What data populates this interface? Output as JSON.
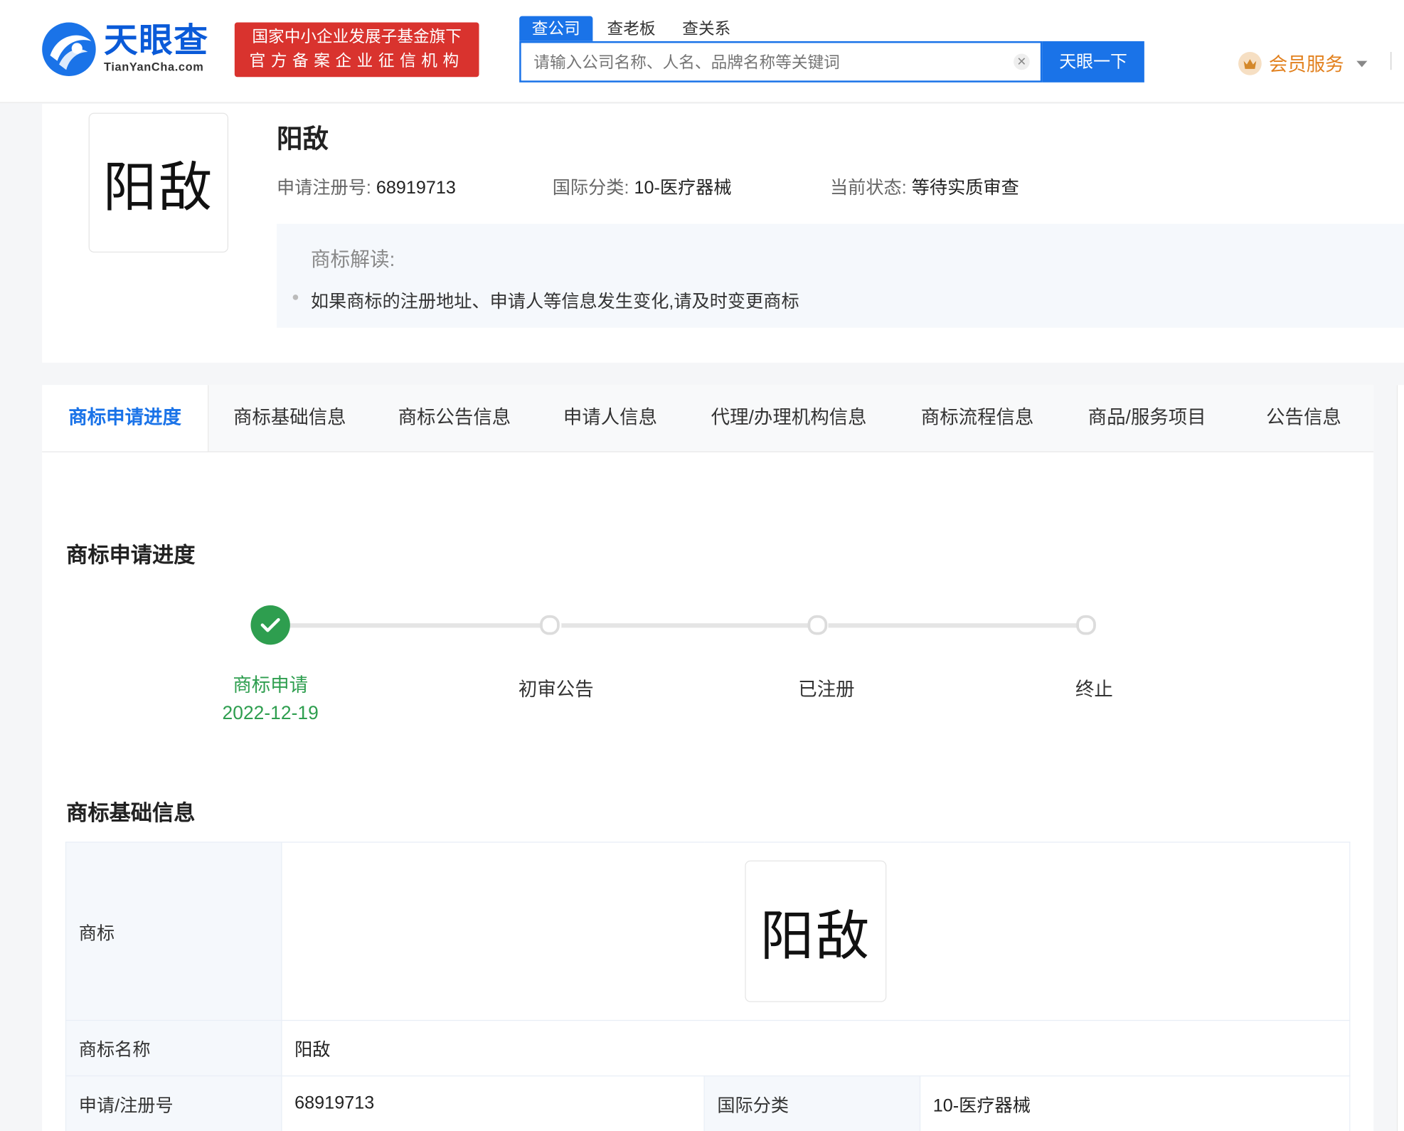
{
  "header": {
    "logo_cn": "天眼查",
    "logo_en": "TianYanCha.com",
    "slogan_line1": "国家中小企业发展子基金旗下",
    "slogan_line2": "官方备案企业征信机构",
    "search_tabs": [
      "查公司",
      "查老板",
      "查关系"
    ],
    "search_placeholder": "请输入公司名称、人名、品牌名称等关键词",
    "search_button": "天眼一下",
    "vip_label": "会员服务"
  },
  "trademark": {
    "logo_text": "阳敌",
    "name": "阳敌",
    "reg_no_label": "申请注册号:",
    "reg_no": "68919713",
    "class_label": "国际分类:",
    "class_value": "10-医疗器械",
    "status_label": "当前状态:",
    "status_value": "等待实质审查",
    "interp_title": "商标解读:",
    "interp_item": "如果商标的注册地址、申请人等信息发生变化,请及时变更商标"
  },
  "tabs": [
    "商标申请进度",
    "商标基础信息",
    "商标公告信息",
    "申请人信息",
    "代理/办理机构信息",
    "商标流程信息",
    "商品/服务项目",
    "公告信息"
  ],
  "progress": {
    "title": "商标申请进度",
    "steps": [
      {
        "label": "商标申请",
        "date": "2022-12-19",
        "done": true
      },
      {
        "label": "初审公告",
        "done": false
      },
      {
        "label": "已注册",
        "done": false
      },
      {
        "label": "终止",
        "done": false
      }
    ]
  },
  "basic_info": {
    "title": "商标基础信息",
    "rows": {
      "logo_key": "商标",
      "name_key": "商标名称",
      "name_value": "阳敌",
      "reg_key": "申请/注册号",
      "reg_value": "68919713",
      "class_key": "国际分类",
      "class_value": "10-医疗器械"
    }
  },
  "colors": {
    "brand_blue": "#1a73e8",
    "slogan_red": "#d9332e",
    "success_green": "#2e9e4f",
    "vip_orange": "#e2801d"
  }
}
